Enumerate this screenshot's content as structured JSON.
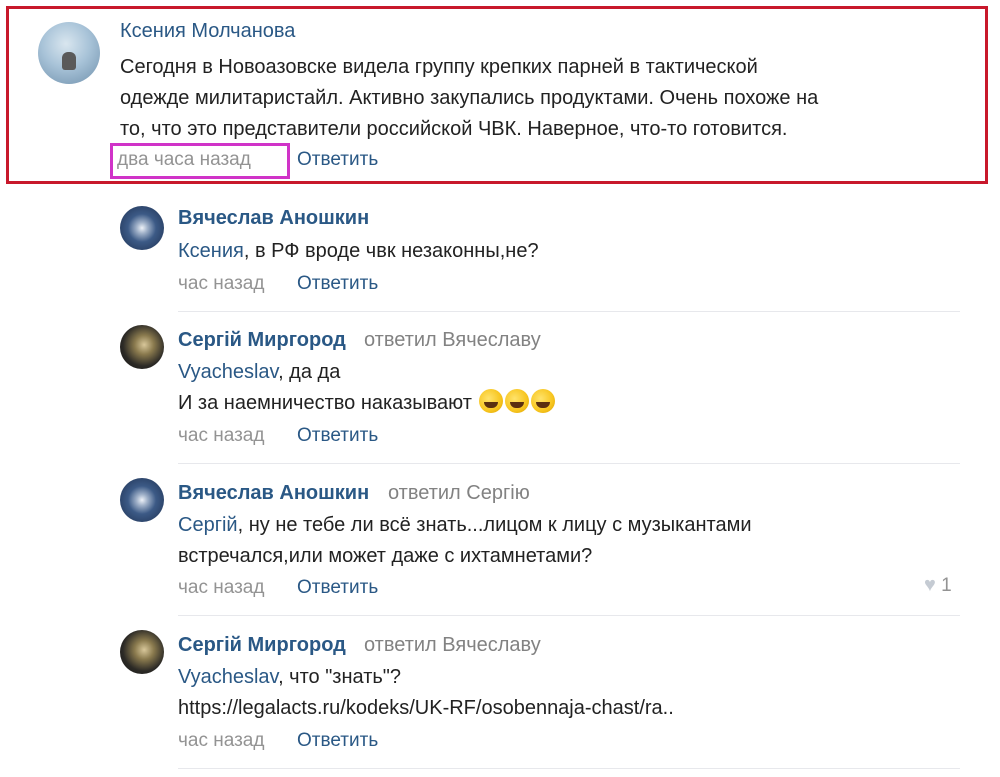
{
  "main_comment": {
    "author": "Ксения Молчанова",
    "lines": [
      "Сегодня в Новоазовске видела группу крепких парней в тактической",
      "одежде милитаристайл. Активно закупались продуктами. Очень похоже на",
      "то, что это представители российской ЧВК. Наверное, что-то готовится."
    ],
    "time": "два часа назад",
    "reply_label": "Ответить"
  },
  "replies": [
    {
      "author": "Вячеслав Аношкин",
      "replied_to": "",
      "mention": "Ксения",
      "text": ", в РФ вроде чвк незаконны,не?",
      "time": "час назад",
      "reply_label": "Ответить"
    },
    {
      "author": "Сергій Миргород",
      "replied_to": "ответил Вячеславу",
      "mention": "Vyacheslav",
      "text": ", да да",
      "text2": "И за наемничество наказывают",
      "emoji_count": 3,
      "time": "час назад",
      "reply_label": "Ответить"
    },
    {
      "author": "Вячеслав Аношкин",
      "replied_to": "ответил Сергію",
      "mention": "Сергій",
      "text": ", ну не тебе ли всё знать...лицом к лицу с музыкантами",
      "text2": "встречался,или может даже с ихтамнетами?",
      "time": "час назад",
      "reply_label": "Ответить",
      "likes": "1"
    },
    {
      "author": "Сергій Миргород",
      "replied_to": "ответил Вячеславу",
      "mention": "Vyacheslav",
      "text": ", что \"знать\"?",
      "text2": "https://legalacts.ru/kodeks/UK-RF/osobennaja-chast/ra..",
      "time": "час назад",
      "reply_label": "Ответить"
    }
  ]
}
